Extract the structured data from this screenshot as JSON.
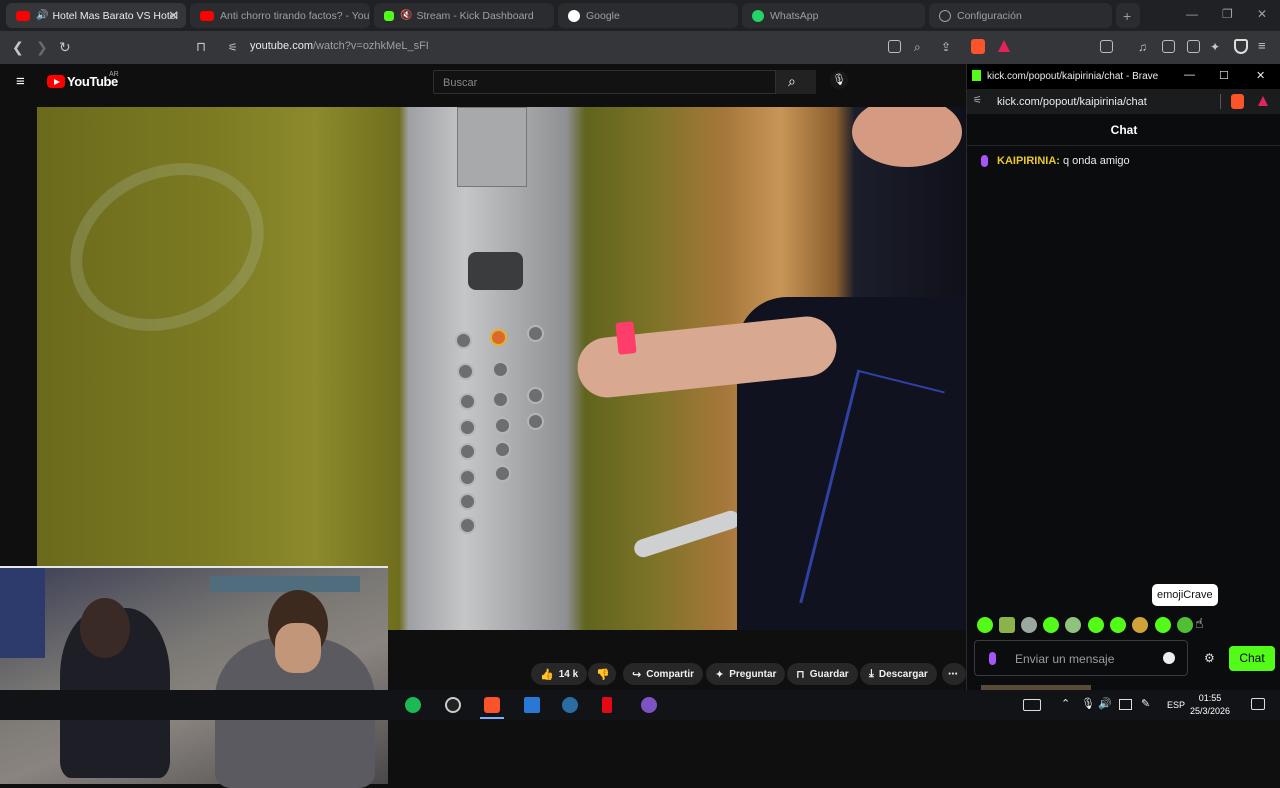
{
  "browser": {
    "tabs": [
      {
        "title": "Hotel Mas Barato VS Hotel",
        "active": true,
        "color": "#ff0000"
      },
      {
        "title": "Anti chorro tirando factos? - YouT",
        "active": false,
        "color": "#ff0000"
      },
      {
        "title": "Stream - Kick Dashboard",
        "active": false,
        "color": "#53fc18"
      },
      {
        "title": "Google",
        "active": false,
        "color": "#4285f4"
      },
      {
        "title": "WhatsApp",
        "active": false,
        "color": "#25d366"
      },
      {
        "title": "Configuración",
        "active": false,
        "color": "#9aa0a6"
      }
    ],
    "url_domain": "youtube.com",
    "url_path": "/watch?v=ozhkMeL_sFI"
  },
  "youtube": {
    "logo": "YouTube",
    "country": "AR",
    "search_placeholder": "Buscar",
    "actions": {
      "likes": "14 k",
      "share": "Compartir",
      "ask": "Preguntar",
      "save": "Guardar",
      "download": "Descargar"
    }
  },
  "chat_window": {
    "title": "kick.com/popout/kaipirinia/chat - Brave",
    "url": "kick.com/popout/kaipirinia/chat",
    "header": "Chat",
    "messages": [
      {
        "user": "KAIPIRINIA:",
        "text": " q onda amigo"
      }
    ],
    "tooltip": "emojiCrave",
    "input_placeholder": "Enviar un mensaje",
    "send_label": "Chat",
    "accent": "#53fc18"
  },
  "taskbar": {
    "lang": "ESP",
    "time": "01:55",
    "date": "25/3/2026"
  }
}
